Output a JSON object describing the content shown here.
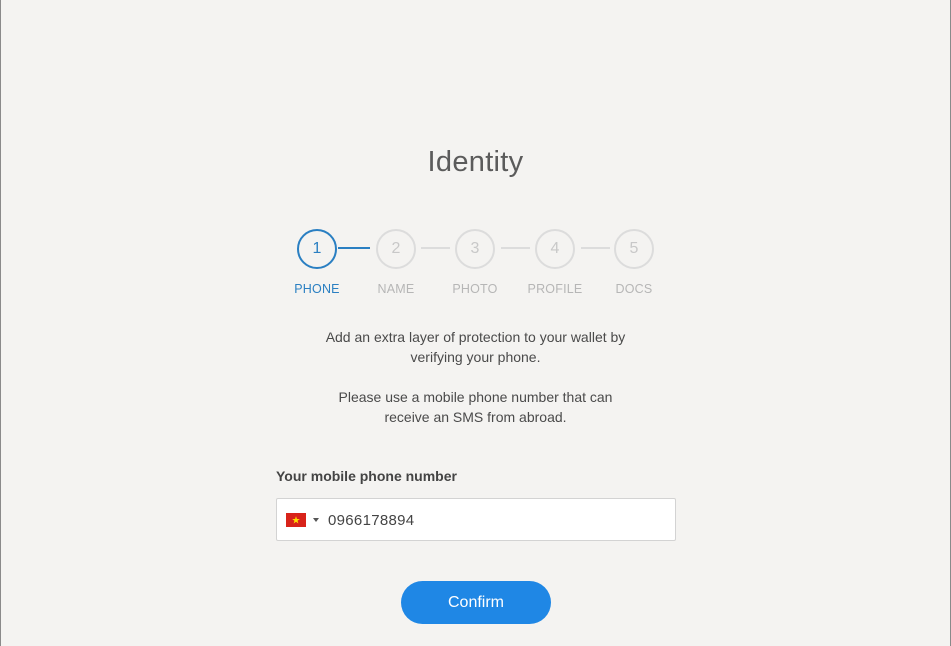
{
  "page": {
    "title": "Identity"
  },
  "stepper": {
    "steps": [
      {
        "number": "1",
        "label": "PHONE",
        "active": true
      },
      {
        "number": "2",
        "label": "NAME",
        "active": false
      },
      {
        "number": "3",
        "label": "PHOTO",
        "active": false
      },
      {
        "number": "4",
        "label": "PROFILE",
        "active": false
      },
      {
        "number": "5",
        "label": "DOCS",
        "active": false
      }
    ]
  },
  "description": {
    "line1": "Add an extra layer of protection to your wallet by",
    "line2": "verifying your phone.",
    "line3": "Please use a mobile phone number that can",
    "line4": "receive an SMS from abroad."
  },
  "phone_field": {
    "label": "Your mobile phone number",
    "country_flag_icon": "vietnam-flag-icon",
    "value": "0966178894"
  },
  "actions": {
    "confirm_label": "Confirm"
  },
  "colors": {
    "accent": "#2a7fc2",
    "button": "#1f87e5",
    "background": "#f4f3f1",
    "inactive": "#dcdcdc"
  }
}
